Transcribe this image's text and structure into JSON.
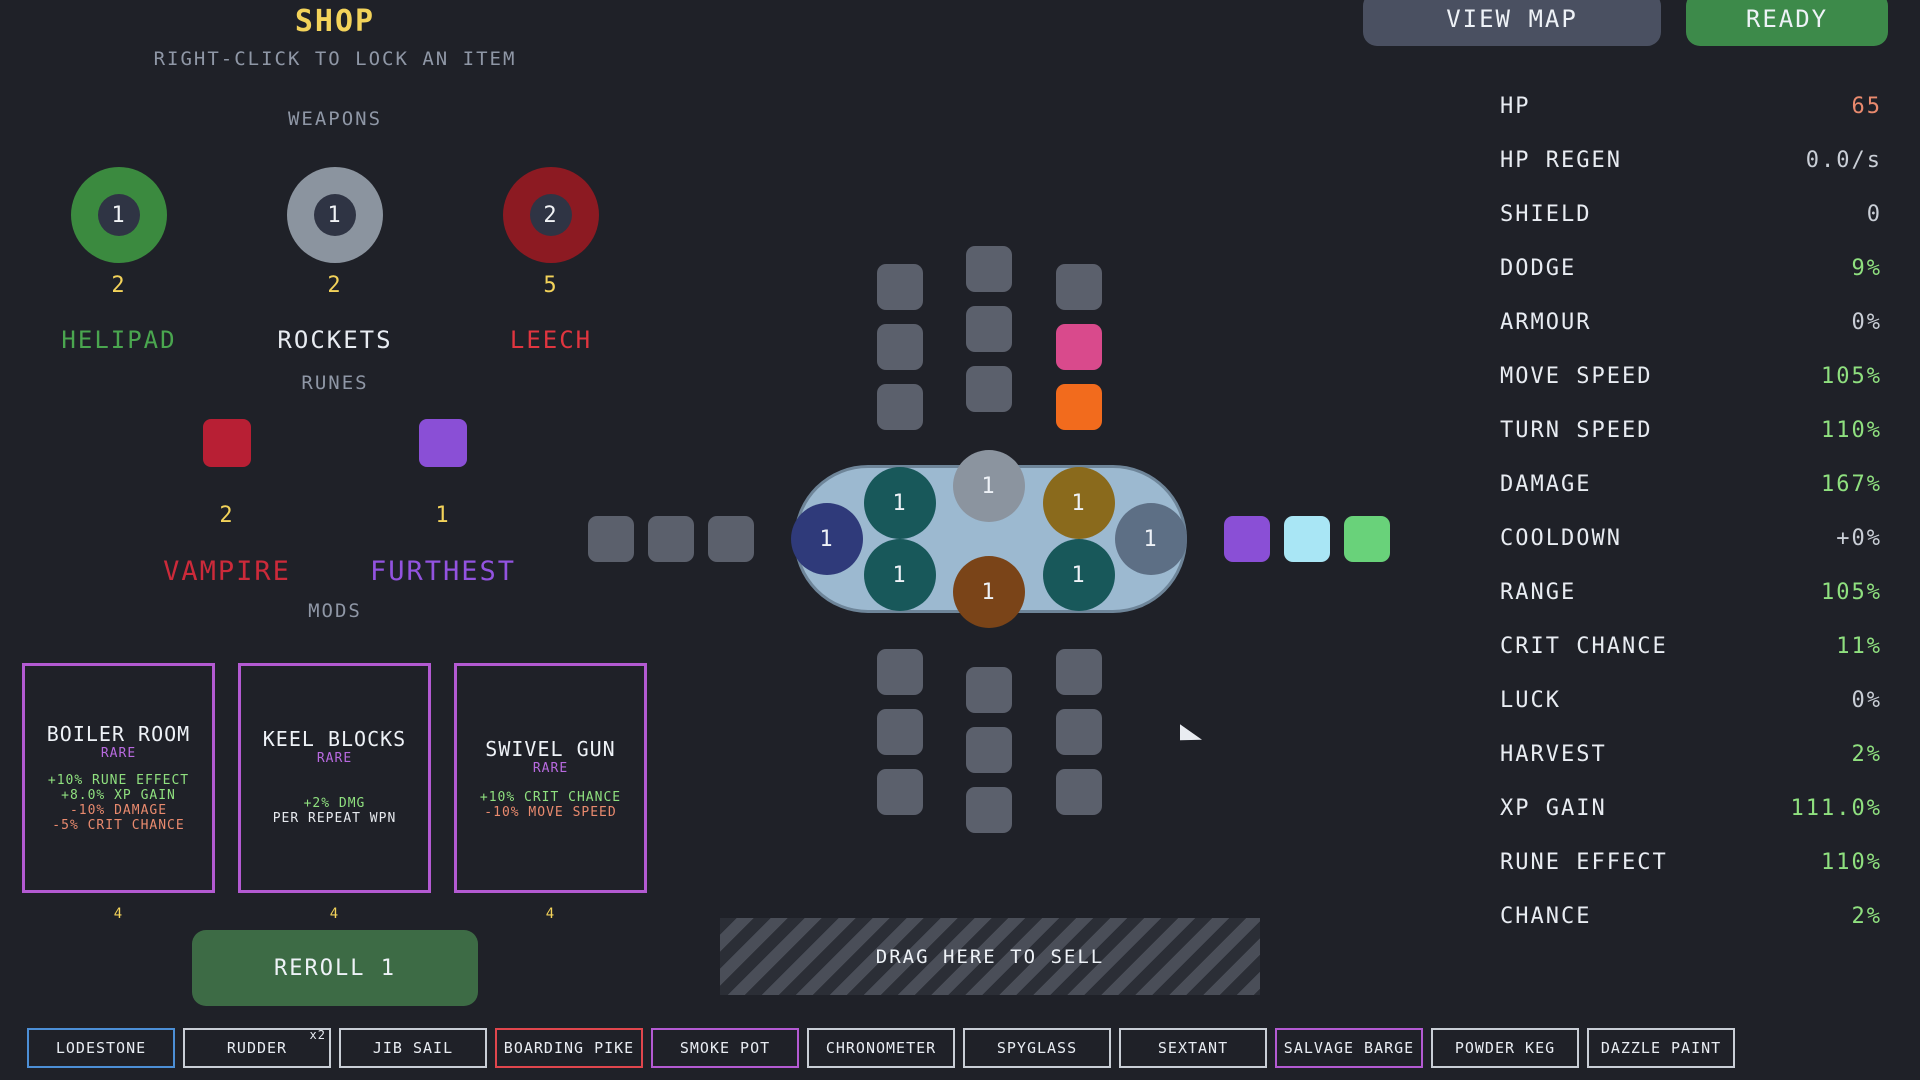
{
  "top": {
    "view_map": "VIEW MAP",
    "ready": "READY"
  },
  "shop": {
    "title": "SHOP",
    "hint": "RIGHT-CLICK TO LOCK AN ITEM",
    "weapons_label": "WEAPONS",
    "weapons": [
      {
        "name": "HELIPAD",
        "level": "1",
        "count": "2",
        "color": "#3b8a3f",
        "name_color": "#4aa64f"
      },
      {
        "name": "ROCKETS",
        "level": "1",
        "count": "2",
        "color": "#8b949f",
        "name_color": "#e8ecf2"
      },
      {
        "name": "LEECH",
        "level": "2",
        "count": "5",
        "color": "#8c1a22",
        "name_color": "#e0353f"
      }
    ],
    "runes_label": "RUNES",
    "runes": [
      {
        "name": "VAMPIRE",
        "count": "2",
        "color": "#b81f34",
        "name_color": "#cc2a3a"
      },
      {
        "name": "FURTHEST",
        "count": "1",
        "color": "#8a4fd6",
        "name_color": "#9353e0"
      }
    ],
    "mods_label": "MODS",
    "mods": [
      {
        "title": "BOILER ROOM",
        "rarity": "RARE",
        "count": "4",
        "lines": [
          {
            "text": "+10% RUNE EFFECT",
            "tone": "pos"
          },
          {
            "text": "+8.0% XP GAIN",
            "tone": "pos"
          },
          {
            "text": "-10% DAMAGE",
            "tone": "neg"
          },
          {
            "text": "-5% CRIT CHANCE",
            "tone": "neg"
          }
        ]
      },
      {
        "title": "KEEL BLOCKS",
        "rarity": "RARE",
        "count": "4",
        "lines": [
          {
            "text": "+2% DMG",
            "tone": "pos"
          },
          {
            "text": "PER REPEAT WPN",
            "tone": "neutral"
          }
        ]
      },
      {
        "title": "SWIVEL GUN",
        "rarity": "RARE",
        "count": "4",
        "lines": [
          {
            "text": "+10% CRIT CHANCE",
            "tone": "pos"
          },
          {
            "text": "-10% MOVE SPEED",
            "tone": "neg"
          }
        ]
      }
    ],
    "reroll_label": "REROLL 1"
  },
  "ship": {
    "weapon_levels": [
      "1",
      "1",
      "1",
      "1",
      "1",
      "1",
      "1",
      "1"
    ],
    "sell_label": "DRAG HERE TO SELL"
  },
  "stats": [
    {
      "label": "HP",
      "value": "65",
      "color": "#e98a6e"
    },
    {
      "label": "HP REGEN",
      "value": "0.0/s",
      "color": "#c9ced6"
    },
    {
      "label": "SHIELD",
      "value": "0",
      "color": "#c9ced6"
    },
    {
      "label": "DODGE",
      "value": "9%",
      "color": "#8fe07f"
    },
    {
      "label": "ARMOUR",
      "value": "0%",
      "color": "#c9ced6"
    },
    {
      "label": "MOVE SPEED",
      "value": "105%",
      "color": "#8fe07f"
    },
    {
      "label": "TURN SPEED",
      "value": "110%",
      "color": "#8fe07f"
    },
    {
      "label": "DAMAGE",
      "value": "167%",
      "color": "#8fe07f"
    },
    {
      "label": "COOLDOWN",
      "value": "+0%",
      "color": "#c9ced6"
    },
    {
      "label": "RANGE",
      "value": "105%",
      "color": "#8fe07f"
    },
    {
      "label": "CRIT CHANCE",
      "value": "11%",
      "color": "#8fe07f"
    },
    {
      "label": "LUCK",
      "value": "0%",
      "color": "#c9ced6"
    },
    {
      "label": "HARVEST",
      "value": "2%",
      "color": "#8fe07f"
    },
    {
      "label": "XP GAIN",
      "value": "111.0%",
      "color": "#8fe07f"
    },
    {
      "label": "RUNE EFFECT",
      "value": "110%",
      "color": "#8fe07f"
    },
    {
      "label": "CHANCE",
      "value": "2%",
      "color": "#8fe07f"
    }
  ],
  "inventory": [
    {
      "label": "LODESTONE",
      "border": "#4c8fd6",
      "badge": ""
    },
    {
      "label": "RUDDER",
      "border": "#c9ced6",
      "badge": "x2"
    },
    {
      "label": "JIB SAIL",
      "border": "#c9ced6",
      "badge": ""
    },
    {
      "label": "BOARDING PIKE",
      "border": "#e0464d",
      "badge": ""
    },
    {
      "label": "SMOKE POT",
      "border": "#b35ad2",
      "badge": ""
    },
    {
      "label": "CHRONOMETER",
      "border": "#c9ced6",
      "badge": ""
    },
    {
      "label": "SPYGLASS",
      "border": "#c9ced6",
      "badge": ""
    },
    {
      "label": "SEXTANT",
      "border": "#c9ced6",
      "badge": ""
    },
    {
      "label": "SALVAGE BARGE",
      "border": "#b35ad2",
      "badge": ""
    },
    {
      "label": "POWDER KEG",
      "border": "#c9ced6",
      "badge": ""
    },
    {
      "label": "DAZZLE PAINT",
      "border": "#c9ced6",
      "badge": ""
    }
  ]
}
